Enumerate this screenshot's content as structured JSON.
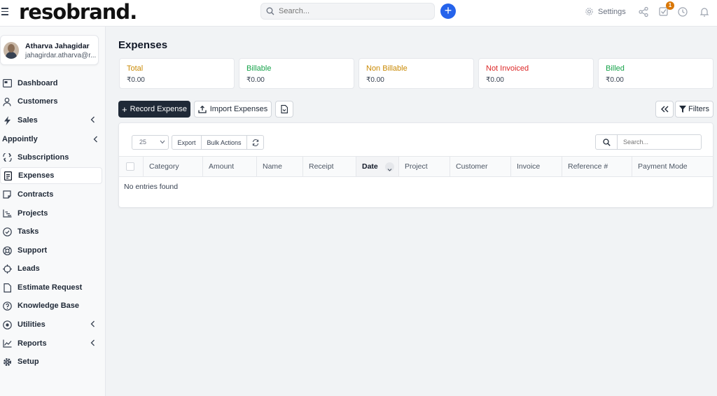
{
  "header": {
    "logo": "resobrand",
    "logo_dot": ".",
    "search_placeholder": "Search...",
    "settings_label": "Settings",
    "tasks_badge": "1"
  },
  "user": {
    "name": "Atharva Jahagidar",
    "email": "jahagirdar.atharva@r..."
  },
  "sidebar": {
    "items": [
      {
        "label": "Dashboard",
        "icon": "dashboard-icon"
      },
      {
        "label": "Customers",
        "icon": "user-icon"
      },
      {
        "label": "Sales",
        "icon": "bolt-icon",
        "chevron": true
      },
      {
        "label": "Appointly",
        "group": true,
        "chevron": true
      },
      {
        "label": "Subscriptions",
        "icon": "repeat-icon"
      },
      {
        "label": "Expenses",
        "icon": "receipt-icon",
        "active": true
      },
      {
        "label": "Contracts",
        "icon": "contract-icon"
      },
      {
        "label": "Projects",
        "icon": "chart-icon"
      },
      {
        "label": "Tasks",
        "icon": "check-circle-icon"
      },
      {
        "label": "Support",
        "icon": "lifebuoy-icon"
      },
      {
        "label": "Leads",
        "icon": "crosshair-icon"
      },
      {
        "label": "Estimate Request",
        "icon": "document-icon"
      },
      {
        "label": "Knowledge Base",
        "icon": "question-icon"
      },
      {
        "label": "Utilities",
        "icon": "target-icon",
        "chevron": true
      },
      {
        "label": "Reports",
        "icon": "line-chart-icon",
        "chevron": true
      },
      {
        "label": "Setup",
        "icon": "cog-icon"
      }
    ]
  },
  "page": {
    "title": "Expenses"
  },
  "stats": [
    {
      "label": "Total",
      "value": "₹0.00",
      "color": "#ca8a04"
    },
    {
      "label": "Billable",
      "value": "₹0.00",
      "color": "#16a34a"
    },
    {
      "label": "Non Billable",
      "value": "₹0.00",
      "color": "#ca8a04"
    },
    {
      "label": "Not Invoiced",
      "value": "₹0.00",
      "color": "#dc2626"
    },
    {
      "label": "Billed",
      "value": "₹0.00",
      "color": "#16a34a"
    }
  ],
  "actions": {
    "record_expense": "Record Expense",
    "import_expenses": "Import Expenses",
    "filters": "Filters"
  },
  "table": {
    "page_length": "25",
    "export_label": "Export",
    "bulk_actions_label": "Bulk Actions",
    "search_placeholder": "Search...",
    "columns": [
      "Category",
      "Amount",
      "Name",
      "Receipt",
      "Date",
      "Project",
      "Customer",
      "Invoice",
      "Reference #",
      "Payment Mode"
    ],
    "empty_message": "No entries found"
  },
  "colors": {
    "primary_button": "#1f2937",
    "accent_blue": "#2563eb",
    "badge": "#d97706"
  }
}
